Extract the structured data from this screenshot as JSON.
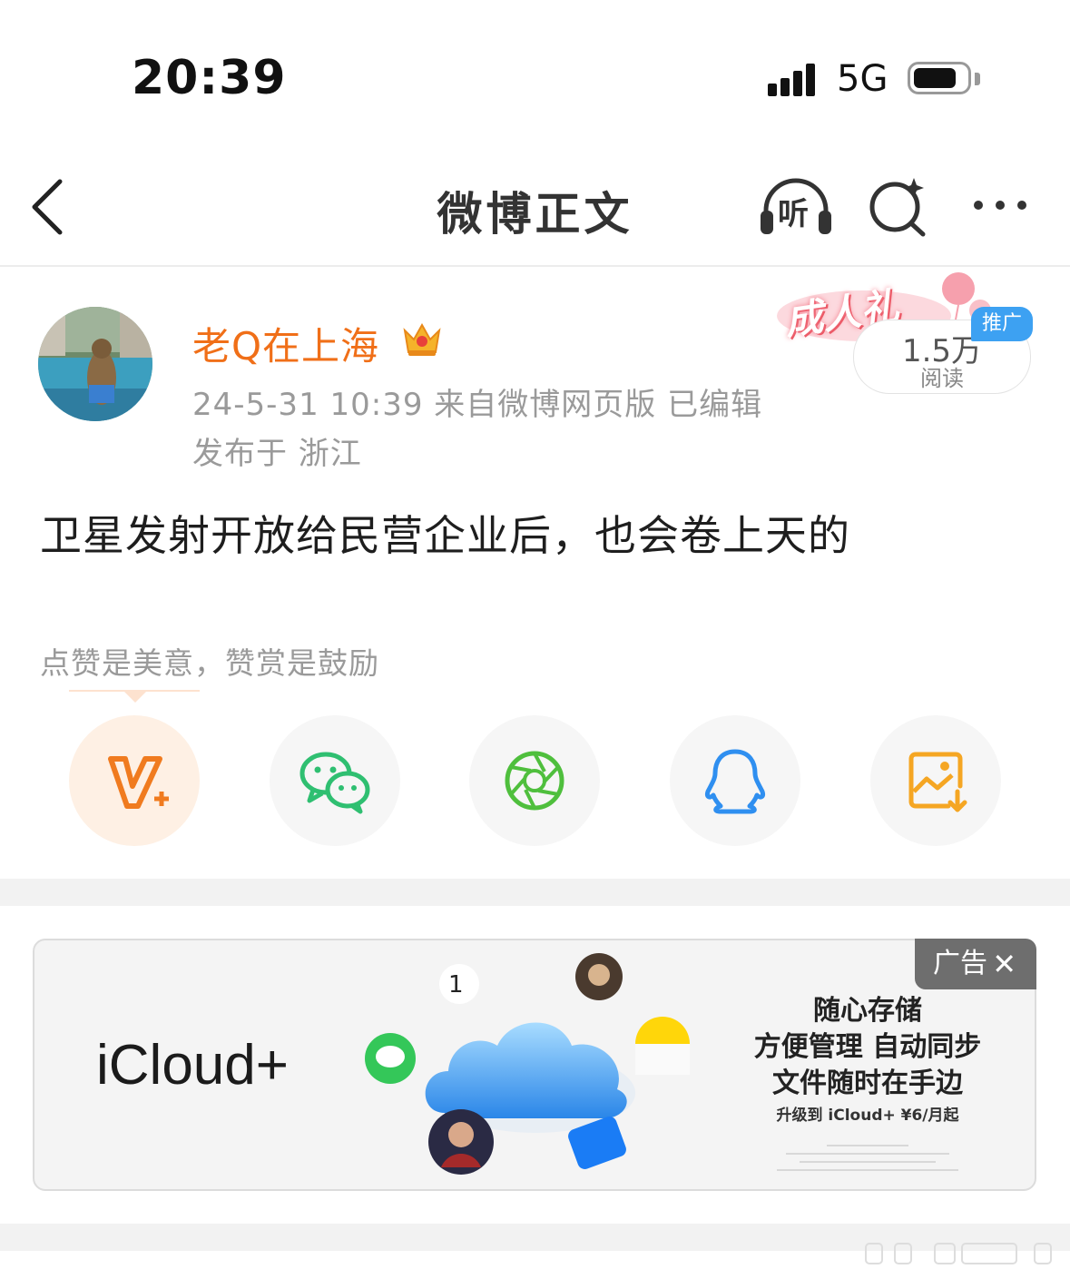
{
  "status_bar": {
    "time": "20:39",
    "network": "5G"
  },
  "header": {
    "title": "微博正文",
    "listen_label": "听"
  },
  "post": {
    "username": "老Q在上海",
    "meta_line": "24-5-31 10:39  来自微博网页版  已编辑",
    "location_line": "发布于 浙江",
    "content": "卫星发射开放给民营企业后，也会卷上天的",
    "reward_prompt": "点赞是美意，赞赏是鼓励"
  },
  "promo": {
    "banner_text": "成人礼",
    "read_count": "1.5万",
    "read_label": "阅读",
    "tag": "推广"
  },
  "share_targets": [
    {
      "icon": "v-plus-icon",
      "color": "#f07b1f"
    },
    {
      "icon": "wechat-icon",
      "color": "#2fbf71"
    },
    {
      "icon": "moments-icon",
      "color": "#4fbf3d"
    },
    {
      "icon": "qq-icon",
      "color": "#2f8ff0"
    },
    {
      "icon": "save-image-icon",
      "color": "#f5a623"
    }
  ],
  "ad": {
    "brand": "iCloud+",
    "line1": "随心存储",
    "line2": "方便管理 自动同步",
    "line3": "文件随时在手边",
    "offer": "升级到 iCloud+ ¥6/月起",
    "tag": "广告",
    "close": "✕",
    "calendar_day": "1"
  },
  "colors": {
    "accent_orange": "#f06f18",
    "meta_gray": "#9a9a9a",
    "promo_blue": "#3da1f2"
  }
}
